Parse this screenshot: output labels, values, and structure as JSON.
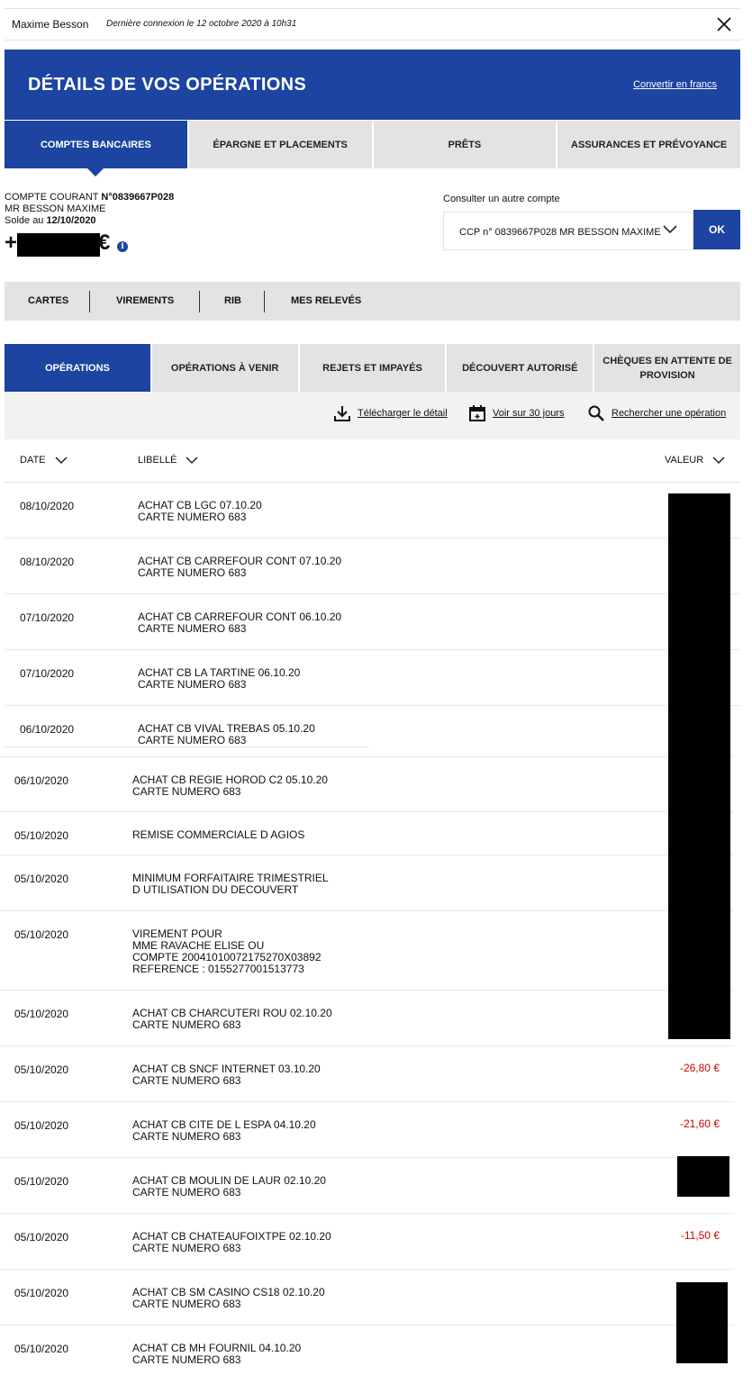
{
  "header": {
    "user_name": "Maxime Besson",
    "last_login": "Dernière connexion le 12 octobre 2020 à 10h31",
    "close_icon": "close-icon"
  },
  "banner": {
    "title": "DÉTAILS DE VOS OPÉRATIONS",
    "convert_link": "Convertir en francs"
  },
  "main_tabs": [
    {
      "label": "COMPTES BANCAIRES",
      "active": true
    },
    {
      "label": "ÉPARGNE ET PLACEMENTS",
      "active": false
    },
    {
      "label": "PRÊTS",
      "active": false
    },
    {
      "label": "ASSURANCES ET PRÉVOYANCE",
      "active": false
    }
  ],
  "account": {
    "type_label": "COMPTE COURANT",
    "number": "N°0839667P028",
    "holder": "MR BESSON MAXIME",
    "balance_label": "Solde au",
    "balance_date": "12/10/2020",
    "balance_sign": "+",
    "currency": "€"
  },
  "other_account": {
    "label": "Consulter un autre compte",
    "selected": "CCP n° 0839667P028 MR BESSON MAXIME",
    "ok_label": "OK"
  },
  "sub_nav": [
    "CARTES",
    "VIREMENTS",
    "RIB",
    "MES RELEVÉS"
  ],
  "op_tabs": [
    {
      "label": "OPÉRATIONS",
      "active": true
    },
    {
      "label": "OPÉRATIONS À VENIR",
      "active": false
    },
    {
      "label": "REJETS ET IMPAYÉS",
      "active": false
    },
    {
      "label": "DÉCOUVERT AUTORISÉ",
      "active": false
    },
    {
      "label": "CHÈQUES EN ATTENTE DE PROVISION",
      "active": false
    }
  ],
  "actions": {
    "download": "Télécharger le détail",
    "view30": "Voir sur 30 jours",
    "search": "Rechercher une opération"
  },
  "table": {
    "headers": {
      "date": "DATE",
      "label": "LIBELLÉ",
      "value": "VALEUR"
    },
    "rows": [
      {
        "date": "08/10/2020",
        "label": "ACHAT CB LGC 07.10.20\nCARTE NUMERO 683",
        "value": ""
      },
      {
        "date": "08/10/2020",
        "label": "ACHAT CB CARREFOUR CONT 07.10.20\nCARTE NUMERO 683",
        "value": ""
      },
      {
        "date": "07/10/2020",
        "label": "ACHAT CB CARREFOUR CONT 06.10.20\nCARTE NUMERO 683",
        "value": ""
      },
      {
        "date": "07/10/2020",
        "label": "ACHAT CB LA TARTINE 06.10.20\nCARTE NUMERO 683",
        "value": ""
      },
      {
        "date": "06/10/2020",
        "label": "ACHAT CB VIVAL TREBAS 05.10.20\nCARTE NUMERO 683",
        "value": ""
      },
      {
        "date": "06/10/2020",
        "label": "ACHAT CB REGIE HOROD C2 05.10.20\nCARTE NUMERO 683",
        "value": ""
      },
      {
        "date": "05/10/2020",
        "label": "REMISE COMMERCIALE D AGIOS",
        "value": ""
      },
      {
        "date": "05/10/2020",
        "label": "MINIMUM FORFAITAIRE TRIMESTRIEL\nD UTILISATION DU DECOUVERT",
        "value": ""
      },
      {
        "date": "05/10/2020",
        "label": "VIREMENT POUR\nMME RAVACHE ELISE OU\nCOMPTE 20041010072175270X03892\nREFERENCE : 0155277001513773",
        "value": ""
      },
      {
        "date": "05/10/2020",
        "label": "ACHAT CB CHARCUTERI ROU 02.10.20\nCARTE NUMERO 683",
        "value": ""
      },
      {
        "date": "05/10/2020",
        "label": "ACHAT CB SNCF INTERNET 03.10.20\nCARTE NUMERO 683",
        "value": "-26,80 €"
      },
      {
        "date": "05/10/2020",
        "label": "ACHAT CB CITE DE L ESPA 04.10.20\nCARTE NUMERO 683",
        "value": "-21,60 €"
      },
      {
        "date": "05/10/2020",
        "label": "ACHAT CB MOULIN DE LAUR 02.10.20\nCARTE NUMERO 683",
        "value": ""
      },
      {
        "date": "05/10/2020",
        "label": "ACHAT CB CHATEAUFOIXTPE 02.10.20\nCARTE NUMERO 683",
        "value": "-11,50 €"
      },
      {
        "date": "05/10/2020",
        "label": "ACHAT CB SM CASINO CS18 02.10.20\nCARTE NUMERO 683",
        "value": ""
      },
      {
        "date": "05/10/2020",
        "label": "ACHAT CB MH FOURNIL 04.10.20\nCARTE NUMERO 683",
        "value": ""
      }
    ]
  },
  "colors": {
    "brand": "#1c44a0",
    "negative": "#cc0000",
    "tab_bg": "#e3e3e3"
  }
}
